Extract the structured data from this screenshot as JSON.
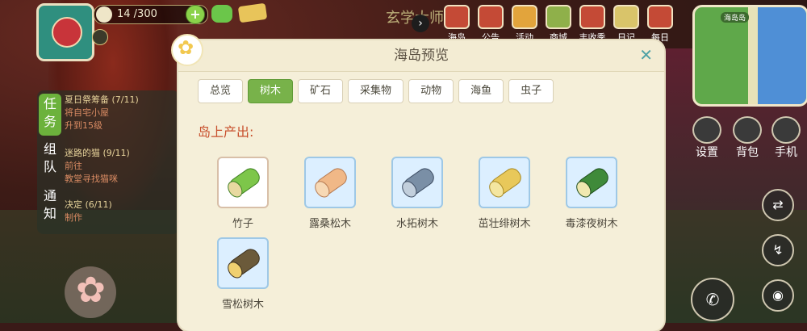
{
  "hud": {
    "coins": "14 /300",
    "scene_title": "玄学大师",
    "nav": [
      {
        "label": "海岛"
      },
      {
        "label": "公告"
      },
      {
        "label": "活动"
      },
      {
        "label": "商城"
      },
      {
        "label": "丰收季"
      },
      {
        "label": "日记"
      },
      {
        "label": "每日"
      }
    ],
    "minimap_label": "海岛岛"
  },
  "tasks": {
    "tabs": [
      {
        "label": "任务"
      },
      {
        "label": "组队"
      },
      {
        "label": "通知"
      }
    ],
    "items": [
      {
        "title": "夏日祭筹备 (7/11)",
        "lines": [
          "将自宅小屋",
          "升到15级"
        ]
      },
      {
        "title": "迷路的猫 (9/11)",
        "lines": [
          "前往",
          "教堂寻找猫咪"
        ]
      },
      {
        "title": "决定 (6/11)",
        "lines": [
          "制作"
        ]
      }
    ]
  },
  "side_buttons": [
    {
      "label": "设置",
      "icon": "gear-icon"
    },
    {
      "label": "背包",
      "icon": "backpack-icon"
    },
    {
      "label": "手机",
      "icon": "phone-icon"
    }
  ],
  "modal": {
    "title": "海岛预览",
    "tabs": [
      {
        "label": "总览",
        "active": false
      },
      {
        "label": "树木",
        "active": true
      },
      {
        "label": "矿石",
        "active": false
      },
      {
        "label": "采集物",
        "active": false
      },
      {
        "label": "动物",
        "active": false
      },
      {
        "label": "海鱼",
        "active": false
      },
      {
        "label": "虫子",
        "active": false
      }
    ],
    "section_title": "岛上产出:",
    "items": [
      {
        "name": "竹子",
        "icon": "bamboo-icon"
      },
      {
        "name": "露桑松木",
        "icon": "pine-log-icon"
      },
      {
        "name": "水拓树木",
        "icon": "water-log-icon"
      },
      {
        "name": "茁壮绯树木",
        "icon": "sturdy-log-icon"
      },
      {
        "name": "毒漆夜树木",
        "icon": "lacquer-log-icon"
      },
      {
        "name": "雪松树木",
        "icon": "cedar-log-icon"
      }
    ]
  }
}
